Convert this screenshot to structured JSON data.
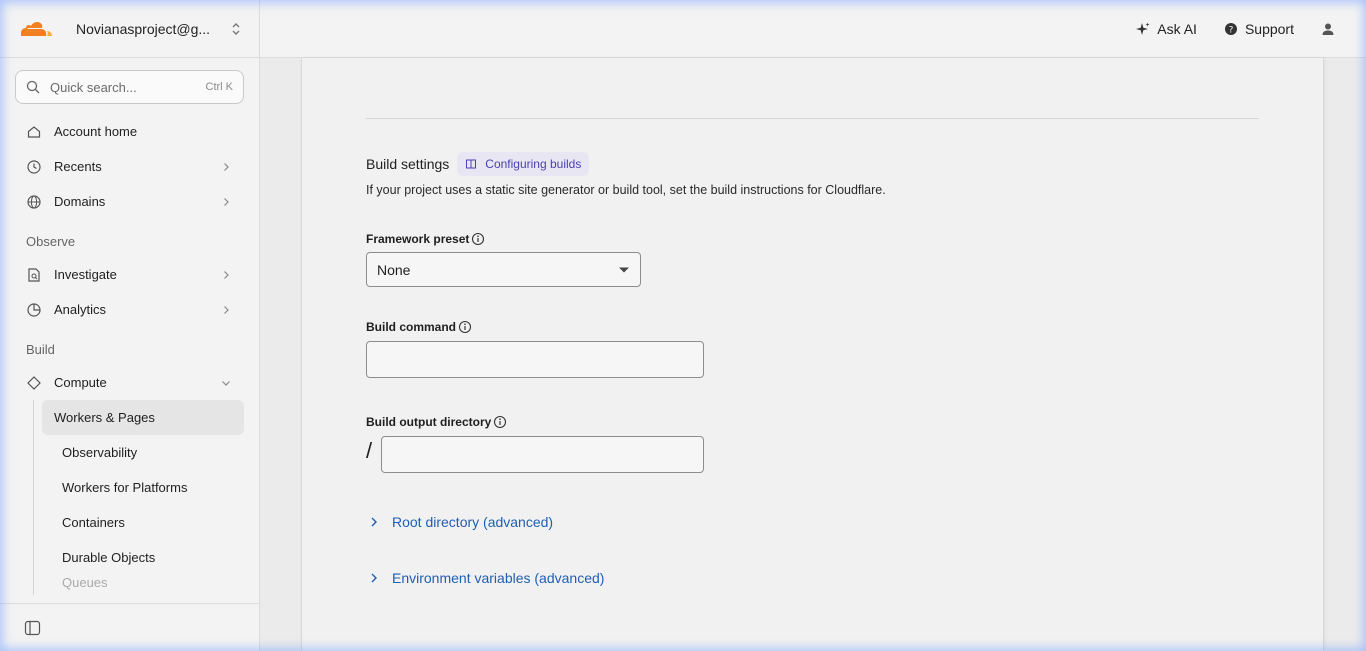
{
  "account": {
    "name": "Novianasproject@g..."
  },
  "search": {
    "placeholder": "Quick search...",
    "shortcut": "Ctrl K"
  },
  "nav": {
    "top_items": [
      {
        "label": "Account home",
        "icon": "home-icon"
      },
      {
        "label": "Recents",
        "icon": "clock-icon"
      },
      {
        "label": "Domains",
        "icon": "globe-icon"
      }
    ],
    "observe_section": "Observe",
    "observe_items": [
      {
        "label": "Investigate",
        "icon": "document-search-icon"
      },
      {
        "label": "Analytics",
        "icon": "pie-chart-icon"
      }
    ],
    "build_section": "Build",
    "compute": {
      "label": "Compute",
      "icon": "diamond-icon"
    },
    "compute_items": [
      {
        "label": "Workers & Pages"
      },
      {
        "label": "Observability"
      },
      {
        "label": "Workers for Platforms"
      },
      {
        "label": "Containers"
      },
      {
        "label": "Durable Objects"
      },
      {
        "label": "Queues"
      }
    ]
  },
  "topbar": {
    "ask_ai": "Ask AI",
    "support": "Support"
  },
  "build": {
    "title": "Build settings",
    "doc_link": "Configuring builds",
    "description": "If your project uses a static site generator or build tool, set the build instructions for Cloudflare.",
    "framework_label": "Framework preset",
    "framework_value": "None",
    "command_label": "Build command",
    "command_value": "",
    "output_label": "Build output directory",
    "output_prefix": "/",
    "output_value": "",
    "root_dir": "Root directory (advanced)",
    "env_vars": "Environment variables (advanced)"
  },
  "colors": {
    "accent": "#F38020",
    "link": "#1E5FB3",
    "pill_text": "#4A3FB5"
  }
}
